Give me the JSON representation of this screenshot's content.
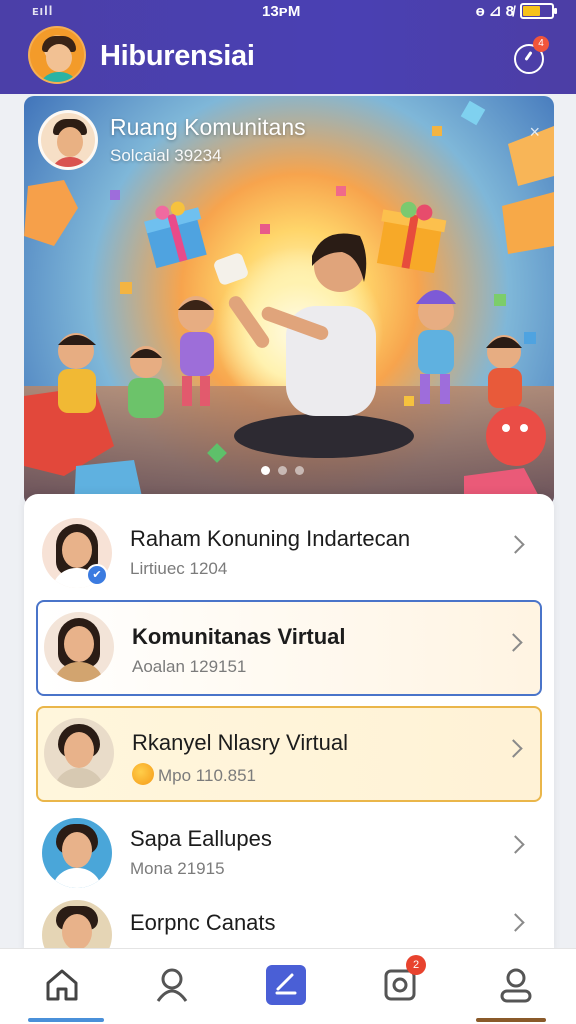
{
  "status_bar": {
    "signal": "ᴇıll",
    "time": "13ᴘM",
    "icons": "ɵ ⊿ 8̸",
    "battery_level": 0.55
  },
  "header": {
    "title": "Hiburensiai",
    "notification_badge": "4",
    "avatar_icon": "cartoon-boy-avatar",
    "notification_icon": "bell-icon"
  },
  "hero": {
    "title": "Ruang Komunitans",
    "subtitle": "Solcaial 39234",
    "close_label": "×",
    "carousel": {
      "count": 3,
      "active_index": 0
    }
  },
  "list": {
    "items": [
      {
        "name": "Raham Konuning Indartecan",
        "sub": "Lirtiuec 1204",
        "verified": true,
        "style": "plain"
      },
      {
        "name": "Komunitanas Virtual",
        "sub": "Aoalan 129151",
        "verified": false,
        "style": "blue"
      },
      {
        "name": "Rkanyel Nlasry Virtual",
        "sub": "Mpo 110.851",
        "verified": false,
        "style": "gold"
      },
      {
        "name": "Sapa Eallupes",
        "sub": "Mona 21915",
        "verified": false,
        "style": "plain"
      },
      {
        "name": "Eorpnc Canats",
        "sub": "",
        "verified": false,
        "style": "plain"
      }
    ]
  },
  "bottom_nav": {
    "items": [
      {
        "icon": "home-icon"
      },
      {
        "icon": "profile-outline-icon"
      },
      {
        "icon": "edit-square-icon"
      },
      {
        "icon": "notification-icon",
        "badge": "2"
      },
      {
        "icon": "account-icon"
      }
    ]
  },
  "colors": {
    "header": "#4a40b3",
    "accent_blue": "#4a74c9",
    "accent_gold": "#eab64a",
    "badge_red": "#e8432e"
  }
}
